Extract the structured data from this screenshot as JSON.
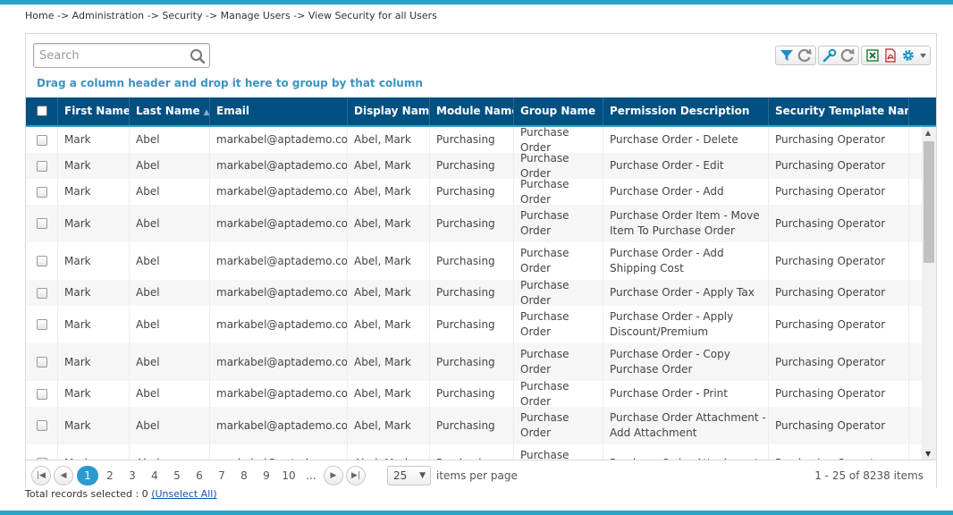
{
  "breadcrumb": "Home -> Administration -> Security -> Manage Users -> View Security for all Users",
  "search": {
    "placeholder": "Search",
    "value": ""
  },
  "toolbar": {
    "icons": [
      "filter-icon",
      "refresh-icon",
      "wrench-icon",
      "refresh-icon",
      "excel-icon",
      "pdf-icon",
      "gear-icon"
    ]
  },
  "group_hint": "Drag a column header and drop it here to group by that column",
  "columns": [
    "First Name",
    "Last Name",
    "Email",
    "Display Name",
    "Module Name",
    "Group Name",
    "Permission Description",
    "Security Template Name"
  ],
  "sorted_column": "Last Name",
  "sort_direction": "ascending",
  "rows": [
    [
      "Mark",
      "Abel",
      "markabel@aptademo.com",
      "Abel, Mark",
      "Purchasing",
      "Purchase Order",
      "Purchase Order - Delete",
      "Purchasing Operator"
    ],
    [
      "Mark",
      "Abel",
      "markabel@aptademo.com",
      "Abel, Mark",
      "Purchasing",
      "Purchase Order",
      "Purchase Order - Edit",
      "Purchasing Operator"
    ],
    [
      "Mark",
      "Abel",
      "markabel@aptademo.com",
      "Abel, Mark",
      "Purchasing",
      "Purchase Order",
      "Purchase Order - Add",
      "Purchasing Operator"
    ],
    [
      "Mark",
      "Abel",
      "markabel@aptademo.com",
      "Abel, Mark",
      "Purchasing",
      "Purchase Order",
      "Purchase Order Item - Move Item To Purchase Order",
      "Purchasing Operator"
    ],
    [
      "Mark",
      "Abel",
      "markabel@aptademo.com",
      "Abel, Mark",
      "Purchasing",
      "Purchase Order",
      "Purchase Order - Add Shipping Cost",
      "Purchasing Operator"
    ],
    [
      "Mark",
      "Abel",
      "markabel@aptademo.com",
      "Abel, Mark",
      "Purchasing",
      "Purchase Order",
      "Purchase Order - Apply Tax",
      "Purchasing Operator"
    ],
    [
      "Mark",
      "Abel",
      "markabel@aptademo.com",
      "Abel, Mark",
      "Purchasing",
      "Purchase Order",
      "Purchase Order - Apply Discount/Premium",
      "Purchasing Operator"
    ],
    [
      "Mark",
      "Abel",
      "markabel@aptademo.com",
      "Abel, Mark",
      "Purchasing",
      "Purchase Order",
      "Purchase Order - Copy Purchase Order",
      "Purchasing Operator"
    ],
    [
      "Mark",
      "Abel",
      "markabel@aptademo.com",
      "Abel, Mark",
      "Purchasing",
      "Purchase Order",
      "Purchase Order - Print",
      "Purchasing Operator"
    ],
    [
      "Mark",
      "Abel",
      "markabel@aptademo.com",
      "Abel, Mark",
      "Purchasing",
      "Purchase Order",
      "Purchase Order Attachment - Add Attachment",
      "Purchasing Operator"
    ],
    [
      "Mark",
      "Abel",
      "markabel@aptademo.com",
      "Abel, Mark",
      "Purchasing",
      "Purchase Order",
      "Purchase Order Attachment -",
      "Purchasing Operator"
    ]
  ],
  "pager": {
    "pages": [
      "1",
      "2",
      "3",
      "4",
      "5",
      "6",
      "7",
      "8",
      "9",
      "10",
      "..."
    ],
    "current_page": "1",
    "page_size": "25",
    "page_size_label": "items per page",
    "info": "1 - 25 of 8238 items"
  },
  "footer": {
    "label": "Total records selected : 0",
    "unselect_label": "(Unselect All)"
  },
  "colors": {
    "accent": "#2aa3c9",
    "header_bg": "#005082",
    "active_page": "#2b9ad0",
    "hint_text": "#3a94c1"
  }
}
